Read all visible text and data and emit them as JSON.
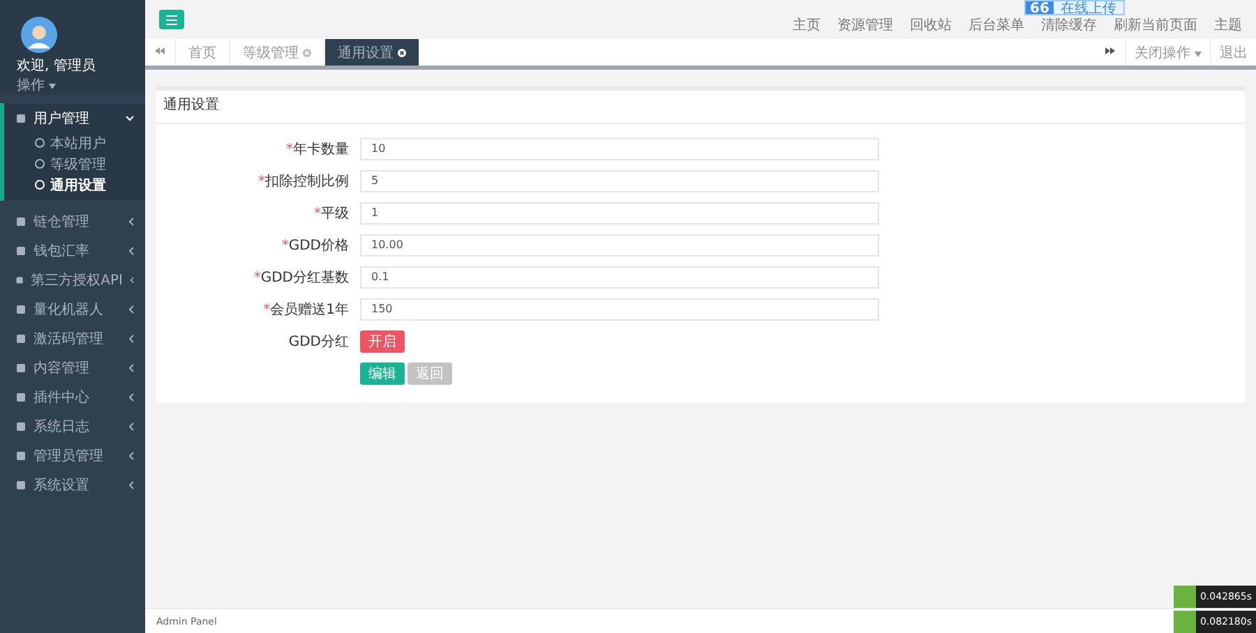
{
  "sidebar": {
    "greeting": "欢迎, 管理员",
    "action": "操作",
    "menu": [
      {
        "label": "用户管理",
        "expanded": true,
        "children": [
          {
            "label": "本站用户",
            "selected": false
          },
          {
            "label": "等级管理",
            "selected": false
          },
          {
            "label": "通用设置",
            "selected": true
          }
        ]
      },
      {
        "label": "链仓管理",
        "expanded": false
      },
      {
        "label": "钱包汇率",
        "expanded": false
      },
      {
        "label": "第三方授权API",
        "expanded": false
      },
      {
        "label": "量化机器人",
        "expanded": false
      },
      {
        "label": "激活码管理",
        "expanded": false
      },
      {
        "label": "内容管理",
        "expanded": false
      },
      {
        "label": "插件中心",
        "expanded": false
      },
      {
        "label": "系统日志",
        "expanded": false
      },
      {
        "label": "管理员管理",
        "expanded": false
      },
      {
        "label": "系统设置",
        "expanded": false
      }
    ]
  },
  "upload_badge": {
    "icon_text": "66",
    "label": "在线上传"
  },
  "top_links": [
    "主页",
    "资源管理",
    "回收站",
    "后台菜单",
    "清除缓存",
    "刷新当前页面",
    "主题"
  ],
  "tabs": [
    {
      "label": "首页",
      "selected": false,
      "closable": false
    },
    {
      "label": "等级管理",
      "selected": false,
      "closable": true
    },
    {
      "label": "通用设置",
      "selected": true,
      "closable": true
    }
  ],
  "tab_actions": {
    "close_menu": "关闭操作",
    "logout": "退出"
  },
  "panel": {
    "title": "通用设置",
    "fields": [
      {
        "kind": "input",
        "mark": "*",
        "label": "年卡数量",
        "value": "10"
      },
      {
        "kind": "input",
        "mark": "*",
        "label": "扣除控制比例",
        "value": "5"
      },
      {
        "kind": "input",
        "mark": "*",
        "label": "平级",
        "value": "1"
      },
      {
        "kind": "input",
        "mark": "*",
        "label": "GDD价格",
        "value": "10.00"
      },
      {
        "kind": "input",
        "mark": "*",
        "label": "GDD分红基数",
        "value": "0.1"
      },
      {
        "kind": "input",
        "mark": "*",
        "label": "会员赠送1年",
        "value": "150"
      },
      {
        "kind": "toggle",
        "label": "GDD分红",
        "value": "开启",
        "on": true
      }
    ],
    "buttons": [
      {
        "label": "编辑",
        "disabled": false
      },
      {
        "label": "返回",
        "disabled": true
      }
    ]
  },
  "footer": "Admin Panel",
  "timings": [
    "0.042865s",
    "0.082180s"
  ]
}
